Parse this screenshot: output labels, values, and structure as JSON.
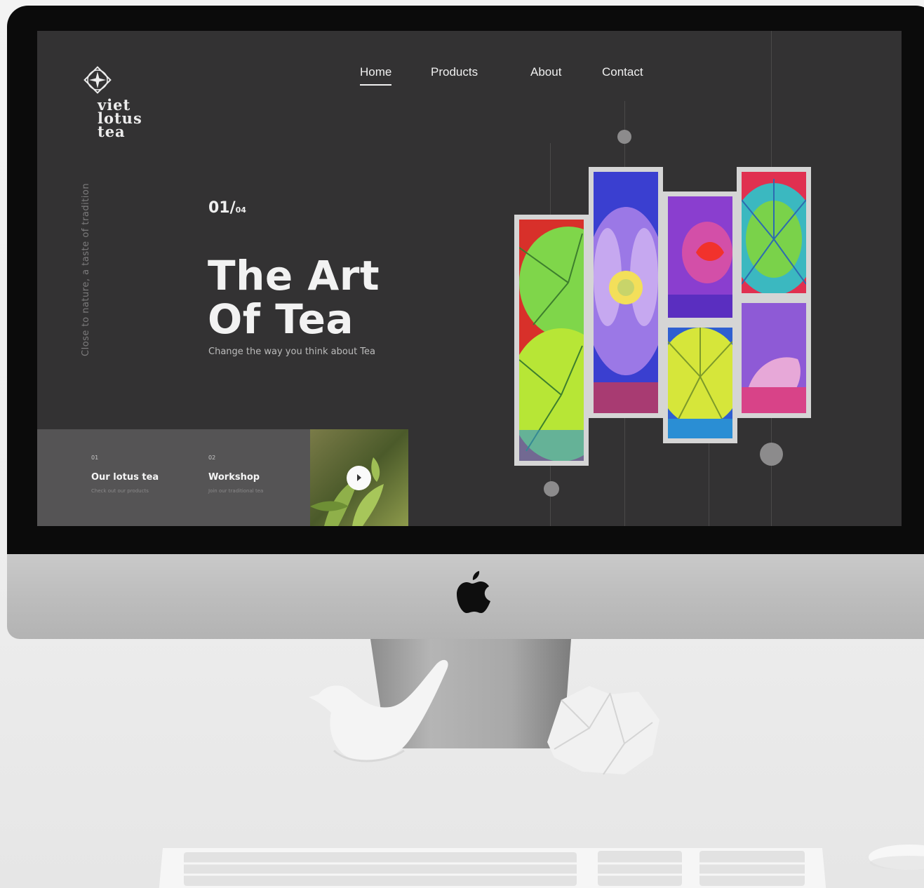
{
  "brand": {
    "name": "viet\nlotus\ntea"
  },
  "nav": {
    "items": [
      {
        "label": "Home",
        "active": true
      },
      {
        "label": "Products",
        "active": false
      },
      {
        "label": "About",
        "active": false
      },
      {
        "label": "Contact",
        "active": false
      }
    ]
  },
  "hero": {
    "tagline": "Close to nature, a taste of tradition",
    "slide_current": "01/",
    "slide_total": "04",
    "title_line1": "The Art",
    "title_line2": "Of Tea",
    "subtitle": "Change the way you think about Tea"
  },
  "cards": [
    {
      "num": "01",
      "title": "Our lotus tea",
      "desc": "Check out our products"
    },
    {
      "num": "02",
      "title": "Workshop",
      "desc": "Join our traditional tea"
    }
  ],
  "video": {
    "icon": "play-icon"
  },
  "colors": {
    "screen_bg": "#333233",
    "card_bg": "#555455",
    "text": "#f2f2f2",
    "muted": "#7c7b7c"
  },
  "icons": [
    "lotus-logo-icon",
    "play-icon",
    "apple-logo-icon"
  ]
}
